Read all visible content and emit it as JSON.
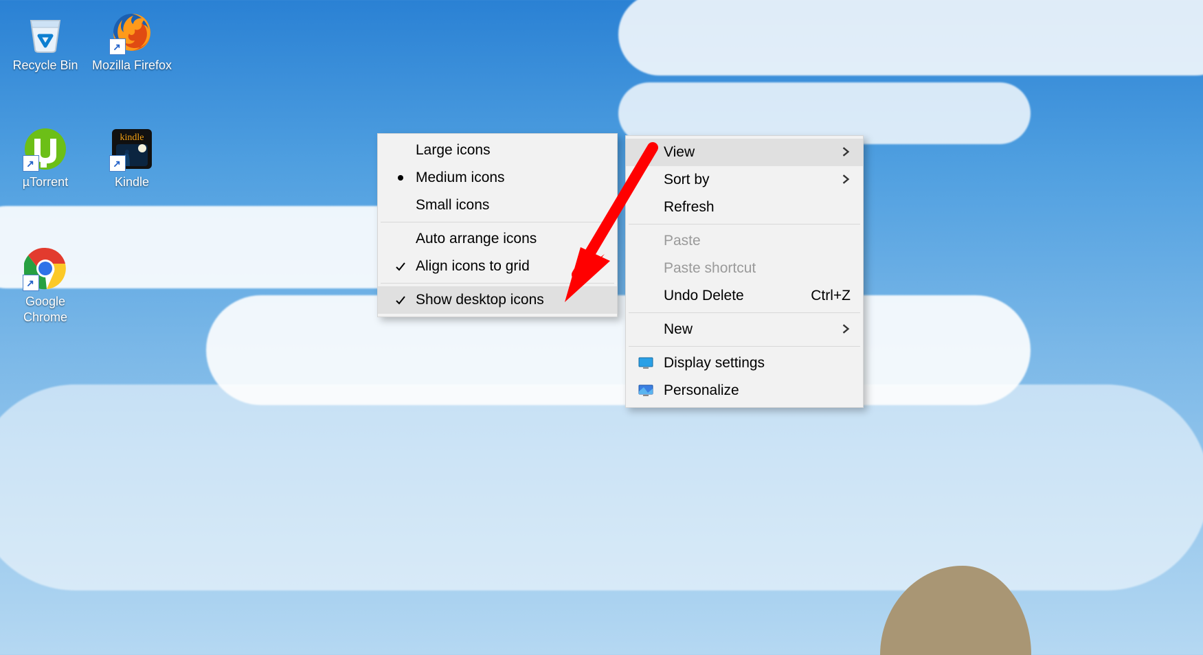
{
  "desktop_icons": {
    "recycle_bin": {
      "label": "Recycle Bin"
    },
    "firefox": {
      "label": "Mozilla Firefox"
    },
    "utorrent": {
      "label": "µTorrent"
    },
    "kindle": {
      "label": "Kindle"
    },
    "chrome": {
      "label": "Google Chrome"
    }
  },
  "context_menu": {
    "view": {
      "label": "View"
    },
    "sort_by": {
      "label": "Sort by"
    },
    "refresh": {
      "label": "Refresh"
    },
    "paste": {
      "label": "Paste"
    },
    "paste_shortcut": {
      "label": "Paste shortcut"
    },
    "undo_delete": {
      "label": "Undo Delete",
      "shortcut": "Ctrl+Z"
    },
    "new": {
      "label": "New"
    },
    "display": {
      "label": "Display settings"
    },
    "personalize": {
      "label": "Personalize"
    }
  },
  "view_submenu": {
    "large": {
      "label": "Large icons",
      "selected": false
    },
    "medium": {
      "label": "Medium icons",
      "selected": true
    },
    "small": {
      "label": "Small icons",
      "selected": false
    },
    "auto": {
      "label": "Auto arrange icons",
      "checked": false
    },
    "align": {
      "label": "Align icons to grid",
      "checked": true
    },
    "show": {
      "label": "Show desktop icons",
      "checked": true,
      "highlighted": true
    }
  }
}
